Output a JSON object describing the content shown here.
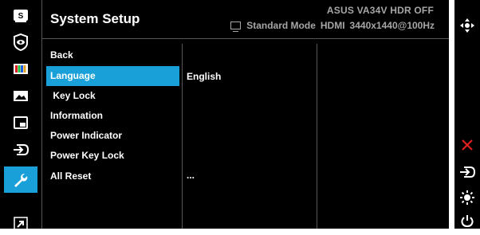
{
  "header": {
    "title": "System Setup",
    "model_line": "ASUS  VA34V HDR OFF",
    "mode": "Standard Mode",
    "input": "HDMI",
    "resolution": "3440x1440@100Hz"
  },
  "sidebar": {
    "items": [
      {
        "icon": "splendid-s-icon"
      },
      {
        "icon": "eye-care-icon"
      },
      {
        "icon": "color-bars-icon"
      },
      {
        "icon": "image-icon"
      },
      {
        "icon": "pip-icon"
      },
      {
        "icon": "input-select-icon"
      },
      {
        "icon": "wrench-icon",
        "active": true
      },
      {
        "icon": "shortcut-arrow-icon"
      }
    ]
  },
  "menu": {
    "items": [
      {
        "label": "Back"
      },
      {
        "label": "Language",
        "selected": true
      },
      {
        "label": " Key Lock"
      },
      {
        "label": "Information"
      },
      {
        "label": "Power Indicator"
      },
      {
        "label": "Power Key Lock"
      },
      {
        "label": "All Reset"
      }
    ]
  },
  "values": {
    "language": "English",
    "all_reset": "..."
  },
  "controls": {
    "items": [
      "joystick-icon",
      "close-icon",
      "input-icon",
      "brightness-icon",
      "power-icon"
    ]
  },
  "colors": {
    "accent": "#1aa0d8",
    "close": "#e02020",
    "background": "#000000",
    "text": "#ffffff",
    "muted": "#a6a6a6"
  }
}
